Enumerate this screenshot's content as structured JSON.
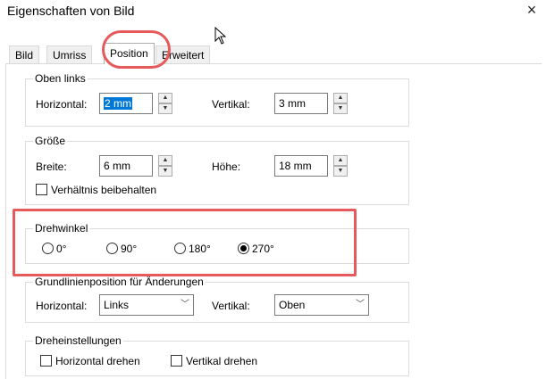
{
  "window": {
    "title": "Eigenschaften von Bild",
    "close_glyph": "×"
  },
  "tabs": [
    {
      "label": "Bild"
    },
    {
      "label": "Umriss"
    },
    {
      "label": "Position"
    },
    {
      "label": "Erweitert"
    }
  ],
  "active_tab": "Position",
  "highlight_color": "#e55a5a",
  "oben_links": {
    "legend": "Oben links",
    "horizontal_label": "Horizontal:",
    "horizontal_value": "2 mm",
    "vertikal_label": "Vertikal:",
    "vertikal_value": "3 mm"
  },
  "groesse": {
    "legend": "Größe",
    "breite_label": "Breite:",
    "breite_value": "6 mm",
    "hoehe_label": "Höhe:",
    "hoehe_value": "18 mm",
    "ratio_label": "Verhältnis beibehalten",
    "ratio_checked": false
  },
  "drehwinkel": {
    "legend": "Drehwinkel",
    "options": [
      "0°",
      "90°",
      "180°",
      "270°"
    ],
    "selected": "270°"
  },
  "grundlinie": {
    "legend": "Grundlinienposition für Änderungen",
    "horizontal_label": "Horizontal:",
    "horizontal_value": "Links",
    "vertikal_label": "Vertikal:",
    "vertikal_value": "Oben"
  },
  "dreheinstellungen": {
    "legend": "Dreheinstellungen",
    "horizontal_drehen": "Horizontal drehen",
    "vertikal_drehen": "Vertikal drehen"
  }
}
